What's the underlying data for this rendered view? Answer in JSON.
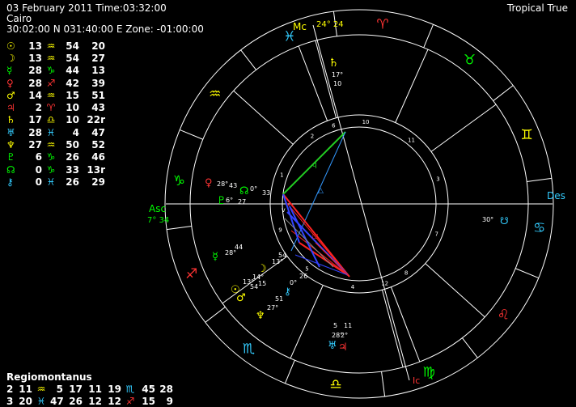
{
  "header": {
    "date_time": "03 February 2011 Time:03:32:00",
    "place": "Cairo",
    "coords": "30:02:00 N 031:40:00 E Zone: -01:00:00",
    "mode": "Tropical True"
  },
  "planets": [
    {
      "glyph": "☉",
      "color": "#ffff00",
      "deg": "13",
      "sign": "♒",
      "sign_color": "#ffff00",
      "min": "54",
      "sec": "20"
    },
    {
      "glyph": "☽",
      "color": "#ffff00",
      "deg": "13",
      "sign": "♒",
      "sign_color": "#ffff00",
      "min": "54",
      "sec": "27"
    },
    {
      "glyph": "☿",
      "color": "#00ff00",
      "deg": "28",
      "sign": "♑",
      "sign_color": "#00ff00",
      "min": "44",
      "sec": "13"
    },
    {
      "glyph": "♀",
      "color": "#ff3333",
      "deg": "28",
      "sign": "♐",
      "sign_color": "#ff3333",
      "min": "42",
      "sec": "39"
    },
    {
      "glyph": "♂",
      "color": "#ffff00",
      "deg": "14",
      "sign": "♒",
      "sign_color": "#ffff00",
      "min": "15",
      "sec": "51"
    },
    {
      "glyph": "♃",
      "color": "#ff3333",
      "deg": "2",
      "sign": "♈",
      "sign_color": "#ff3333",
      "min": "10",
      "sec": "43"
    },
    {
      "glyph": "♄",
      "color": "#ffff00",
      "deg": "17",
      "sign": "♎",
      "sign_color": "#ffff00",
      "min": "10",
      "sec": "22r"
    },
    {
      "glyph": "♅",
      "color": "#33ccff",
      "deg": "28",
      "sign": "♓",
      "sign_color": "#33ccff",
      "min": "4",
      "sec": "47"
    },
    {
      "glyph": "♆",
      "color": "#ffff00",
      "deg": "27",
      "sign": "♒",
      "sign_color": "#ffff00",
      "min": "50",
      "sec": "52"
    },
    {
      "glyph": "♇",
      "color": "#00ff00",
      "deg": "6",
      "sign": "♑",
      "sign_color": "#00ff00",
      "min": "26",
      "sec": "46"
    },
    {
      "glyph": "☊",
      "color": "#00ff00",
      "deg": "0",
      "sign": "♑",
      "sign_color": "#00ff00",
      "min": "33",
      "sec": "13r"
    },
    {
      "glyph": "⚷",
      "color": "#33ccff",
      "deg": "0",
      "sign": "♓",
      "sign_color": "#33ccff",
      "min": "26",
      "sec": "29"
    }
  ],
  "regio": {
    "title": "Regiomontanus",
    "rows": [
      {
        "h1": "2",
        "d1": "11",
        "s1": "♒",
        "s1c": "#ffff00",
        "h2": "5",
        "d2": "17",
        "h3": "11",
        "d3": "19",
        "s3": "♏",
        "s3c": "#33ccff",
        "m1": "45",
        "m2": "28"
      },
      {
        "h1": "3",
        "d1": "20",
        "s1": "♓",
        "s1c": "#33ccff",
        "h2": "47",
        "d2": "26",
        "h3": "12",
        "d3": "12",
        "s3": "♐",
        "s3c": "#ff3333",
        "m1": "15",
        "m2": "9"
      }
    ]
  },
  "wheel": {
    "labels": {
      "asc": "Asc",
      "asc_deg": "7° 34",
      "des": "Des",
      "mc": "Mc",
      "mc_deg": "24° 24",
      "ic": "Ic"
    },
    "house_numbers": [
      "1",
      "2",
      "3",
      "4",
      "5",
      "6",
      "7",
      "8",
      "9",
      "10",
      "11",
      "12"
    ],
    "zodiac": [
      {
        "glyph": "♑",
        "color": "#00ff00"
      },
      {
        "glyph": "♒",
        "color": "#ffff00"
      },
      {
        "glyph": "♓",
        "color": "#33ccff"
      },
      {
        "glyph": "♈",
        "color": "#ff3333"
      },
      {
        "glyph": "♉",
        "color": "#00ff00"
      },
      {
        "glyph": "♊",
        "color": "#ffff00"
      },
      {
        "glyph": "♋",
        "color": "#33ccff"
      },
      {
        "glyph": "♌",
        "color": "#ff3333"
      },
      {
        "glyph": "♍",
        "color": "#00ff00"
      },
      {
        "glyph": "♎",
        "color": "#ffff00"
      },
      {
        "glyph": "♏",
        "color": "#33ccff"
      },
      {
        "glyph": "♐",
        "color": "#ff3333"
      }
    ],
    "chart_planets": [
      {
        "glyph": "♄",
        "color": "#ffff00",
        "d": "17°",
        "m": "10"
      },
      {
        "glyph": "♀",
        "color": "#ff3333",
        "d": "28°",
        "m": "43"
      },
      {
        "glyph": "♇",
        "color": "#00ff00",
        "d": "6°",
        "m": "27"
      },
      {
        "glyph": "☊",
        "color": "#00ff00",
        "d": "0°",
        "m": "33"
      },
      {
        "glyph": "☿",
        "color": "#00ff00",
        "d": "28°",
        "m": "44"
      },
      {
        "glyph": "☽",
        "color": "#ffff00",
        "d": "13°",
        "m": "54"
      },
      {
        "glyph": "☉",
        "color": "#ffff00",
        "d": "13°",
        "m": "54"
      },
      {
        "glyph": "♂",
        "color": "#ffff00",
        "d": "14°",
        "m": "15"
      },
      {
        "glyph": "♆",
        "color": "#ffff00",
        "d": "27°",
        "m": "51"
      },
      {
        "glyph": "⚷",
        "color": "#33ccff",
        "d": "0°",
        "m": "26"
      },
      {
        "glyph": "♅",
        "color": "#33ccff",
        "d": "28°",
        "m": "5"
      },
      {
        "glyph": "♃",
        "color": "#ff3333",
        "d": "2°",
        "m": "11"
      },
      {
        "glyph": "☋",
        "color": "#33ccff",
        "d": "30°",
        "m": "33"
      }
    ]
  }
}
